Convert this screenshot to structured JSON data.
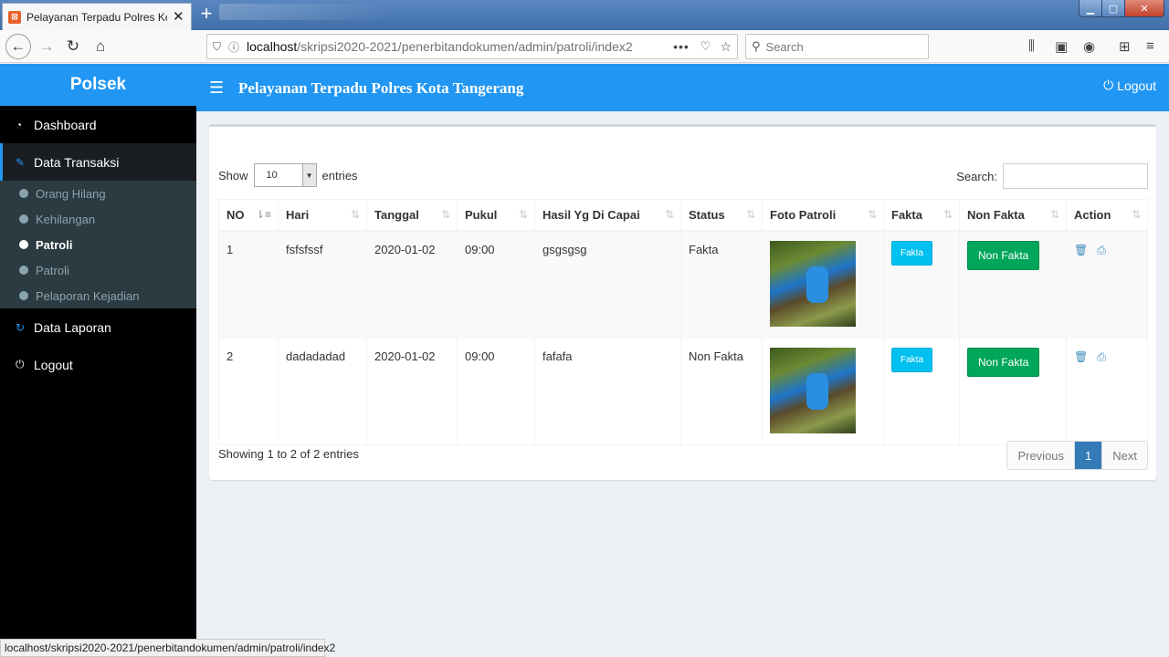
{
  "browser": {
    "tab_title": "Pelayanan Terpadu Polres Kota",
    "url_host": "localhost",
    "url_path": "/skripsi2020-2021/penerbitandokumen/admin/patroli/index2",
    "search_placeholder": "Search",
    "status_url": "localhost/skripsi2020-2021/penerbitandokumen/admin/patroli/index2"
  },
  "header": {
    "brand": "Polsek",
    "title": "Pelayanan Terpadu Polres Kota Tangerang",
    "logout": "Logout"
  },
  "sidebar": {
    "dashboard": "Dashboard",
    "data_transaksi": "Data Transaksi",
    "submenu": [
      "Orang Hilang",
      "Kehilangan",
      "Patroli",
      "Patroli",
      "Pelaporan Kejadian"
    ],
    "data_laporan": "Data Laporan",
    "logout": "Logout"
  },
  "table_controls": {
    "show": "Show",
    "entries_value": "10",
    "entries": "entries",
    "search_label": "Search:"
  },
  "table": {
    "columns": [
      "NO",
      "Hari",
      "Tanggal",
      "Pukul",
      "Hasil Yg Di Capai",
      "Status",
      "Foto Patroli",
      "Fakta",
      "Non Fakta",
      "Action"
    ],
    "rows": [
      {
        "no": "1",
        "hari": "fsfsfssf",
        "tanggal": "2020-01-02",
        "pukul": "09:00",
        "hasil": "gsgsgsg",
        "status": "Fakta",
        "fakta_btn": "Fakta",
        "nonfakta_btn": "Non Fakta"
      },
      {
        "no": "2",
        "hari": "dadadadad",
        "tanggal": "2020-01-02",
        "pukul": "09:00",
        "hasil": "fafafa",
        "status": "Non Fakta",
        "fakta_btn": "Fakta",
        "nonfakta_btn": "Non Fakta"
      }
    ]
  },
  "footer": {
    "info": "Showing 1 to 2 of 2 entries",
    "previous": "Previous",
    "page": "1",
    "next": "Next"
  },
  "colors": {
    "header_blue": "#2196f3",
    "fakta": "#00c0ef",
    "nonfakta": "#00a65a",
    "pager_active": "#337ab7"
  }
}
